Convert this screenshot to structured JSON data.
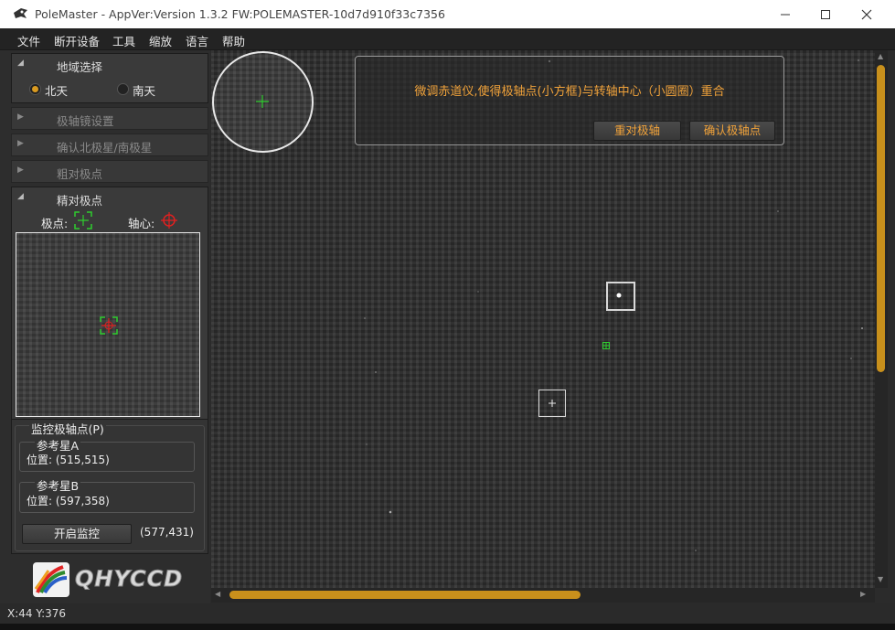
{
  "window": {
    "title": "PoleMaster - AppVer:Version 1.3.2 FW:POLEMASTER-10d7d910f33c7356",
    "app_icon": "polemaster-logo-icon",
    "controls": [
      "minimize-icon",
      "maximize-icon",
      "close-icon"
    ]
  },
  "menu": {
    "items": [
      "文件",
      "断开设备",
      "工具",
      "缩放",
      "语言",
      "帮助"
    ]
  },
  "sidebar": {
    "region": {
      "title": "地域选择",
      "options": [
        {
          "label": "北天",
          "checked": true
        },
        {
          "label": "南天",
          "checked": false
        }
      ]
    },
    "sections": [
      "极轴镜设置",
      "确认北极星/南极星",
      "粗对极点"
    ],
    "fine": {
      "title": "精对极点",
      "pole_label": "极点:",
      "axis_label": "轴心:"
    },
    "monitor": {
      "title": "监控极轴点(P)",
      "star_a": {
        "title": "参考星A",
        "position": "位置: (515,515)"
      },
      "star_b": {
        "title": "参考星B",
        "position": "位置: (597,358)"
      },
      "start_button": "开启监控",
      "coords": "(577,431)"
    },
    "logo": {
      "text": "QHYCCD",
      "icon": "qhyccd-logo-icon"
    }
  },
  "instruction": {
    "text": "微调赤道仪,使得极轴点(小方框)与转轴中心（小圆圈）重合",
    "reset_button": "重对极轴",
    "confirm_button": "确认极轴点"
  },
  "status": {
    "cursor": "X:44 Y:376"
  },
  "colors": {
    "accent": "#f0a23a",
    "radio_checked": "#d99a20",
    "scrollbar_thumb": "#c8901c",
    "marker_green": "#2ecc2e",
    "marker_red": "#e02020"
  }
}
